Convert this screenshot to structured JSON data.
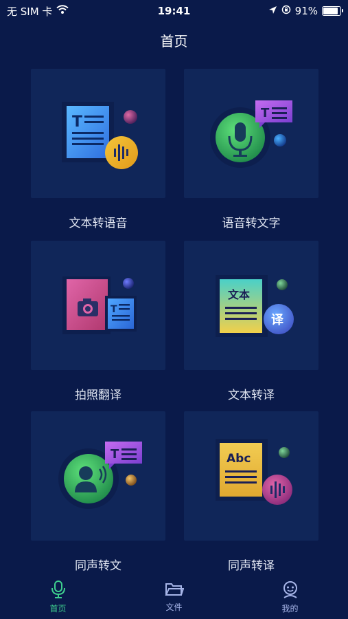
{
  "status_bar": {
    "carrier": "无 SIM 卡",
    "time": "19:41",
    "battery_text": "91%",
    "battery_level": 0.91
  },
  "header": {
    "title": "首页"
  },
  "features": [
    {
      "label": "文本转语音"
    },
    {
      "label": "语音转文字"
    },
    {
      "label": "拍照翻译"
    },
    {
      "label": "文本转译"
    },
    {
      "label": "同声转文"
    },
    {
      "label": "同声转译"
    }
  ],
  "icon_text": {
    "wen_ben": "文本",
    "yi": "译",
    "abc": "Abc"
  },
  "tabbar": {
    "items": [
      {
        "label": "首页",
        "active": true
      },
      {
        "label": "文件",
        "active": false
      },
      {
        "label": "我的",
        "active": false
      }
    ]
  },
  "colors": {
    "background": "#0a1a4a",
    "tile": "#102659",
    "active_tab": "#3ecf8e",
    "inactive_tab": "#a7b5e8"
  }
}
